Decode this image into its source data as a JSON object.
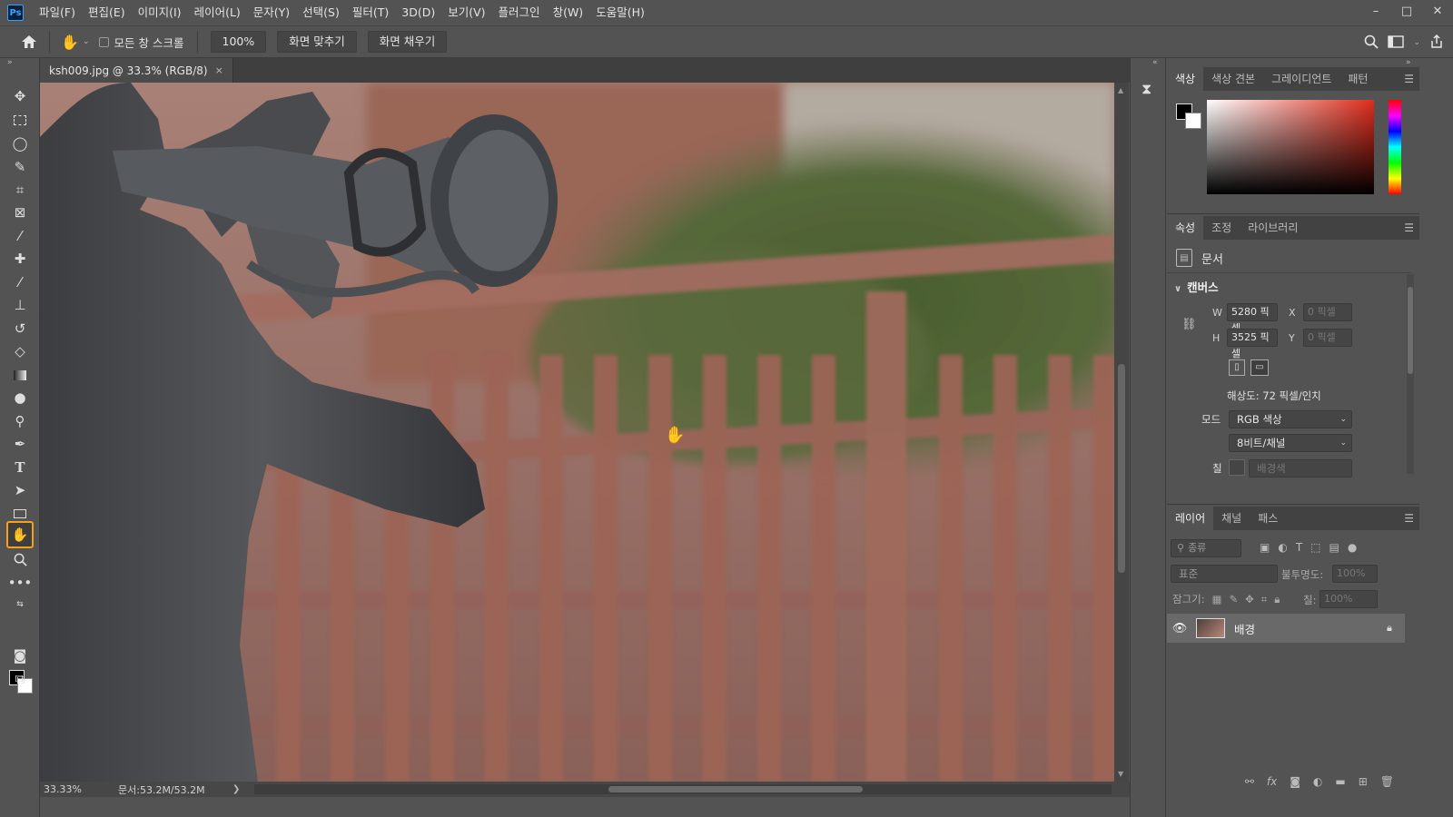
{
  "app": {
    "logo": "Ps"
  },
  "menu": [
    "파일(F)",
    "편집(E)",
    "이미지(I)",
    "레이어(L)",
    "문자(Y)",
    "선택(S)",
    "필터(T)",
    "3D(D)",
    "보기(V)",
    "플러그인",
    "창(W)",
    "도움말(H)"
  ],
  "window_controls": {
    "minimize": "–",
    "maximize": "□",
    "close": "✕"
  },
  "options": {
    "scroll_all_label": "모든 창 스크롤",
    "zoom_value": "100%",
    "fit_screen": "화면 맞추기",
    "fill_screen": "화면 채우기"
  },
  "document": {
    "tab_title": "ksh009.jpg @ 33.3% (RGB/8)",
    "tab_close": "×",
    "status_zoom": "33.33%",
    "status_doc": "문서:53.2M/53.2M"
  },
  "panels": {
    "color_tabs": [
      "색상",
      "색상 견본",
      "그레이디언트",
      "패턴"
    ],
    "properties_tabs": [
      "속성",
      "조정",
      "라이브러리"
    ],
    "layers_tabs": [
      "레이어",
      "채널",
      "패스"
    ]
  },
  "properties": {
    "doc_label": "문서",
    "canvas_header": "캔버스",
    "w_label": "W",
    "w_value": "5280 픽셀",
    "h_label": "H",
    "h_value": "3525 픽셀",
    "x_label": "X",
    "x_value": "0 픽셀",
    "y_label": "Y",
    "y_value": "0 픽셀",
    "resolution": "해상도: 72 픽셀/인치",
    "mode_label": "모드",
    "mode_value": "RGB 색상",
    "depth_value": "8비트/채널",
    "fill_label": "칠",
    "fill_value": "배경색"
  },
  "layers": {
    "filter_placeholder": "종류",
    "blend_mode": "표준",
    "opacity_label": "불투명도:",
    "opacity_value": "100%",
    "lock_label": "잠그기:",
    "fill_label": "칠:",
    "fill_value": "100%",
    "items": [
      {
        "name": "배경",
        "visible": true,
        "locked": true
      }
    ]
  },
  "colors": {
    "accent_active_tool": "#f4a11b",
    "foreground": "#000000",
    "background": "#ffffff"
  }
}
